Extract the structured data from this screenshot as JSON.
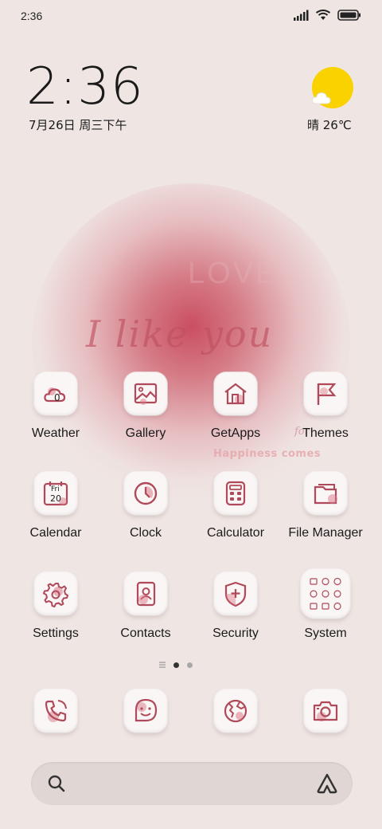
{
  "status_bar": {
    "time": "2:36"
  },
  "clock_widget": {
    "time": "2:36",
    "date": "7月26日 周三下午"
  },
  "weather_widget": {
    "text": "晴 26℃"
  },
  "wallpaper": {
    "line1": "I like you",
    "line2": "Happiness comes",
    "line3": "LOVE",
    "line4": "for"
  },
  "apps": {
    "weather": "Weather",
    "gallery": "Gallery",
    "getapps": "GetApps",
    "themes": "Themes",
    "calendar": "Calendar",
    "clock": "Clock",
    "calculator": "Calculator",
    "file_manager": "File Manager",
    "settings": "Settings",
    "contacts": "Contacts",
    "security": "Security",
    "system": "System"
  },
  "calendar_icon": {
    "day": "Fri",
    "date": "20"
  },
  "weather_icon": {
    "temp": "0"
  },
  "colors": {
    "accent": "#b04a5a",
    "sun": "#f9d200"
  }
}
